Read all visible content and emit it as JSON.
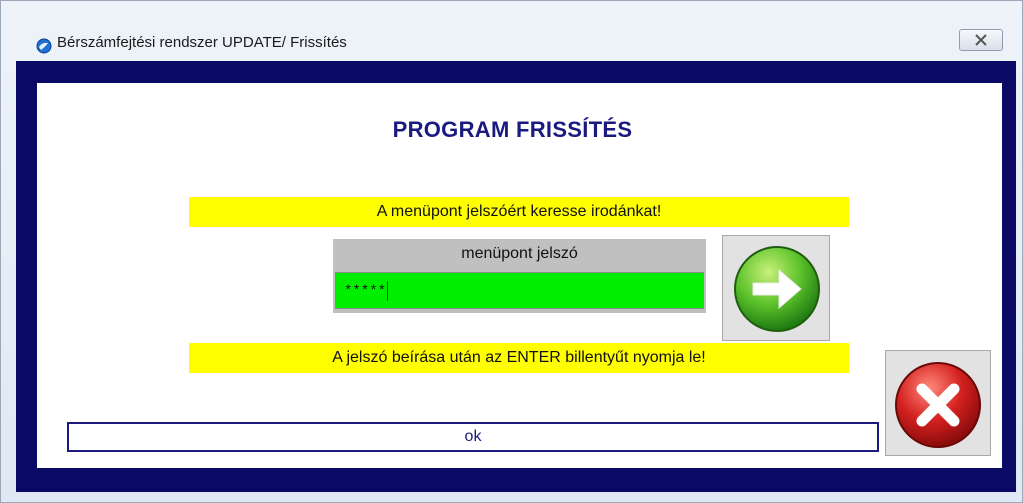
{
  "window": {
    "title": "Bérszámfejtési rendszer UPDATE/ Frissítés",
    "app_icon": "globe-app-icon",
    "close_icon": "close-icon"
  },
  "dialog": {
    "heading": "PROGRAM FRISSÍTÉS",
    "notice_top": "A menüpont jelszóért keresse irodánkat!",
    "password_label": "menüpont jelszó",
    "password_value": "*****",
    "go_button_icon": "arrow-right-icon",
    "notice_bottom": "A jelszó beírása után az ENTER billentyűt nyomja le!",
    "cancel_button_icon": "cancel-x-icon",
    "status_text": "ok"
  },
  "colors": {
    "frame": "#0a0a66",
    "heading": "#1a1a80",
    "notice_bg": "#ffff00",
    "input_bg": "#00ee00",
    "panel_bg": "#c0c0c0",
    "go_green": "#3cb021",
    "cancel_red": "#d42020"
  }
}
